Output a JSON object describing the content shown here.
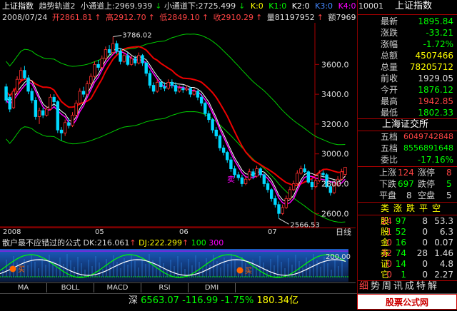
{
  "header": {
    "index_name": "上证指数",
    "indicator_name": "趋势轨道2",
    "ch_upper_label": "小通道上:",
    "ch_upper_value": "2969.939",
    "ch_lower_label": "小通道下:",
    "ch_lower_value": "2725.499",
    "k0": "K:0",
    "k1": "K1:0",
    "k2": "K2:0",
    "k3": "K3:0",
    "k4": "K4:0"
  },
  "ohlc": {
    "date": "2008/07/24",
    "open": "开2861.81",
    "high": "高2912.70",
    "low": "低2849.10",
    "close": "收2910.29",
    "volume": "量81197952",
    "amount": "额7969065",
    "toggle": "换"
  },
  "chart": {
    "y_labels": [
      "3600.0",
      "3400.0",
      "3200.0",
      "3000.0",
      "2800.0",
      "2600.0"
    ],
    "peak_label": "3786.02",
    "trough_label": "2566.53",
    "x_labels": [
      "2008",
      "05",
      "06",
      "07"
    ],
    "period_label": "日线",
    "sell_marker": "卖",
    "buy_marker": "买"
  },
  "chart_data": {
    "type": "candlestick",
    "y_ticks": [
      3600,
      3400,
      3200,
      3000,
      2800,
      2600
    ],
    "ylim": [
      2520,
      3860
    ],
    "peak": 3786.02,
    "trough": 2566.53,
    "candles": [
      [
        3450,
        3360,
        3470,
        3340
      ],
      [
        3380,
        3300,
        3400,
        3280
      ],
      [
        3310,
        3420,
        3440,
        3300
      ],
      [
        3420,
        3500,
        3520,
        3400
      ],
      [
        3500,
        3560,
        3580,
        3480
      ],
      [
        3560,
        3510,
        3590,
        3500
      ],
      [
        3510,
        3420,
        3530,
        3400
      ],
      [
        3420,
        3360,
        3440,
        3340
      ],
      [
        3360,
        3250,
        3380,
        3230
      ],
      [
        3250,
        3290,
        3310,
        3200
      ],
      [
        3290,
        3260,
        3310,
        3240
      ],
      [
        3260,
        3300,
        3320,
        3250
      ],
      [
        3300,
        3380,
        3400,
        3290
      ],
      [
        3380,
        3350,
        3400,
        3320
      ],
      [
        3350,
        3160,
        3360,
        3140
      ],
      [
        3160,
        3140,
        3180,
        3090
      ],
      [
        3140,
        3210,
        3230,
        3120
      ],
      [
        3210,
        3190,
        3240,
        3170
      ],
      [
        3190,
        3260,
        3280,
        3180
      ],
      [
        3260,
        3340,
        3360,
        3250
      ],
      [
        3340,
        3420,
        3440,
        3330
      ],
      [
        3420,
        3400,
        3450,
        3380
      ],
      [
        3400,
        3470,
        3490,
        3390
      ],
      [
        3470,
        3520,
        3540,
        3460
      ],
      [
        3520,
        3600,
        3620,
        3510
      ],
      [
        3600,
        3580,
        3630,
        3560
      ],
      [
        3580,
        3640,
        3660,
        3570
      ],
      [
        3640,
        3700,
        3720,
        3630
      ],
      [
        3700,
        3680,
        3730,
        3660
      ],
      [
        3680,
        3740,
        3786,
        3670
      ],
      [
        3740,
        3690,
        3760,
        3670
      ],
      [
        3690,
        3620,
        3710,
        3600
      ],
      [
        3620,
        3660,
        3680,
        3610
      ],
      [
        3660,
        3600,
        3680,
        3590
      ],
      [
        3600,
        3640,
        3660,
        3590
      ],
      [
        3640,
        3610,
        3660,
        3590
      ],
      [
        3610,
        3660,
        3680,
        3600
      ],
      [
        3660,
        3610,
        3670,
        3590
      ],
      [
        3610,
        3540,
        3620,
        3520
      ],
      [
        3540,
        3460,
        3560,
        3440
      ],
      [
        3460,
        3420,
        3480,
        3400
      ],
      [
        3420,
        3480,
        3500,
        3410
      ],
      [
        3480,
        3450,
        3500,
        3430
      ],
      [
        3450,
        3440,
        3480,
        3420
      ],
      [
        3440,
        3480,
        3500,
        3430
      ],
      [
        3480,
        3460,
        3500,
        3440
      ],
      [
        3460,
        3420,
        3480,
        3400
      ],
      [
        3420,
        3440,
        3460,
        3410
      ],
      [
        3440,
        3430,
        3460,
        3410
      ],
      [
        3430,
        3440,
        3460,
        3420
      ],
      [
        3440,
        3400,
        3450,
        3380
      ],
      [
        3400,
        3420,
        3440,
        3390
      ],
      [
        3420,
        3380,
        3430,
        3360
      ],
      [
        3380,
        3340,
        3400,
        3320
      ],
      [
        3340,
        3270,
        3350,
        3250
      ],
      [
        3270,
        3230,
        3290,
        3210
      ],
      [
        3230,
        3160,
        3240,
        3140
      ],
      [
        3160,
        3120,
        3180,
        3100
      ],
      [
        3120,
        3040,
        3130,
        3020
      ],
      [
        3040,
        3010,
        3060,
        2990
      ],
      [
        3010,
        2960,
        3020,
        2940
      ],
      [
        2960,
        2900,
        2980,
        2880
      ],
      [
        2900,
        2860,
        2920,
        2840
      ],
      [
        2860,
        2840,
        2880,
        2820
      ],
      [
        2840,
        2800,
        2860,
        2780
      ],
      [
        2800,
        2830,
        2850,
        2790
      ],
      [
        2830,
        2880,
        2900,
        2820
      ],
      [
        2880,
        2850,
        2900,
        2830
      ],
      [
        2850,
        2900,
        2920,
        2840
      ],
      [
        2900,
        2860,
        2910,
        2840
      ],
      [
        2860,
        2800,
        2870,
        2780
      ],
      [
        2800,
        2760,
        2820,
        2740
      ],
      [
        2760,
        2700,
        2770,
        2680
      ],
      [
        2700,
        2660,
        2720,
        2640
      ],
      [
        2660,
        2600,
        2680,
        2566.53
      ],
      [
        2600,
        2640,
        2660,
        2590
      ],
      [
        2640,
        2700,
        2720,
        2630
      ],
      [
        2700,
        2760,
        2780,
        2690
      ],
      [
        2760,
        2800,
        2820,
        2750
      ],
      [
        2800,
        2870,
        2890,
        2790
      ],
      [
        2870,
        2900,
        2920,
        2860
      ],
      [
        2900,
        2880,
        2930,
        2870
      ],
      [
        2880,
        2810,
        2890,
        2800
      ],
      [
        2810,
        2780,
        2830,
        2760
      ],
      [
        2780,
        2820,
        2840,
        2770
      ],
      [
        2820,
        2870,
        2890,
        2810
      ],
      [
        2870,
        2860,
        2890,
        2840
      ],
      [
        2860,
        2780,
        2870,
        2770
      ],
      [
        2780,
        2740,
        2800,
        2720
      ],
      [
        2740,
        2790,
        2810,
        2730
      ],
      [
        2790,
        2830,
        2850,
        2780
      ],
      [
        2830,
        2880,
        2900,
        2820
      ],
      [
        2861.81,
        2910.29,
        2912.7,
        2849.1
      ]
    ],
    "indicator": {
      "name": "散户最不应错过的公式",
      "DK": "216.061",
      "DJ": "222.299",
      "DJ_arrow": "↑",
      "DK_arrow": "↑",
      "v1": "100",
      "v2": "300",
      "level": "200.00"
    }
  },
  "indicator_bar": {
    "name": "散户最不应错过的公式",
    "dk": "DK:216.061",
    "dj": "DJ:222.299",
    "v1": "100",
    "v2": "300",
    "level": "200.00"
  },
  "tabs": [
    "MA",
    "BOLL",
    "MACD",
    "RSI",
    "DMI"
  ],
  "bottom": {
    "shen_label": "深",
    "shen_value": "6563.07",
    "shen_change": "-116.99",
    "shen_pct": "-1.75%",
    "shen_amount": "180.34亿",
    "watermark": "股票公式网 www.88gs.com"
  },
  "quote": {
    "code": "10001",
    "name": "上证指数",
    "rows": [
      {
        "label": "最新",
        "value": "1895.84"
      },
      {
        "label": "涨跌",
        "value": "-33.21"
      },
      {
        "label": "涨幅",
        "value": "-1.72%"
      },
      {
        "label": "总额",
        "value": "4507466"
      },
      {
        "label": "总量",
        "value": "78205712"
      },
      {
        "label": "前收",
        "value": "1929.05"
      },
      {
        "label": "今开",
        "value": "1876.12"
      },
      {
        "label": "最高",
        "value": "1942.85"
      },
      {
        "label": "最低",
        "value": "1802.33"
      }
    ],
    "exchange": "上海证交所",
    "wu_jia": "五档",
    "buy5": "6049742848",
    "sell5": "8556891648",
    "weibi_label": "委比",
    "weibi": "-17.16%",
    "up_label": "上涨",
    "up_count": "124",
    "limit_up_label": "涨停",
    "limit_up": "8",
    "down_label": "下跌",
    "down_count": "697",
    "limit_down_label": "跌停",
    "limit_down": "5",
    "flat_label": "平盘",
    "flat_count": "8",
    "empty_label": "空盘",
    "empty_count": "5",
    "cat_tabs": [
      "类",
      "涨",
      "跌",
      "平",
      "空"
    ],
    "sectors": [
      {
        "k": "股",
        "a": "24",
        "b": "97",
        "c": "8",
        "d": "53.3"
      },
      {
        "k": "股",
        "a": "1",
        "b": "52",
        "c": "0",
        "d": "6.3"
      },
      {
        "k": "金",
        "a": "0",
        "b": "16",
        "c": "0",
        "d": "0.07"
      },
      {
        "k": "券",
        "a": "32",
        "b": "74",
        "c": "28",
        "d": "1.46"
      },
      {
        "k": "证",
        "a": "0",
        "b": "14",
        "c": "0",
        "d": "4.8"
      },
      {
        "k": "它",
        "a": "0",
        "b": "1",
        "c": "0",
        "d": "2.27"
      }
    ],
    "footer_tabs": [
      "细",
      "势",
      "周",
      "讯",
      "成",
      "特",
      "解"
    ]
  }
}
